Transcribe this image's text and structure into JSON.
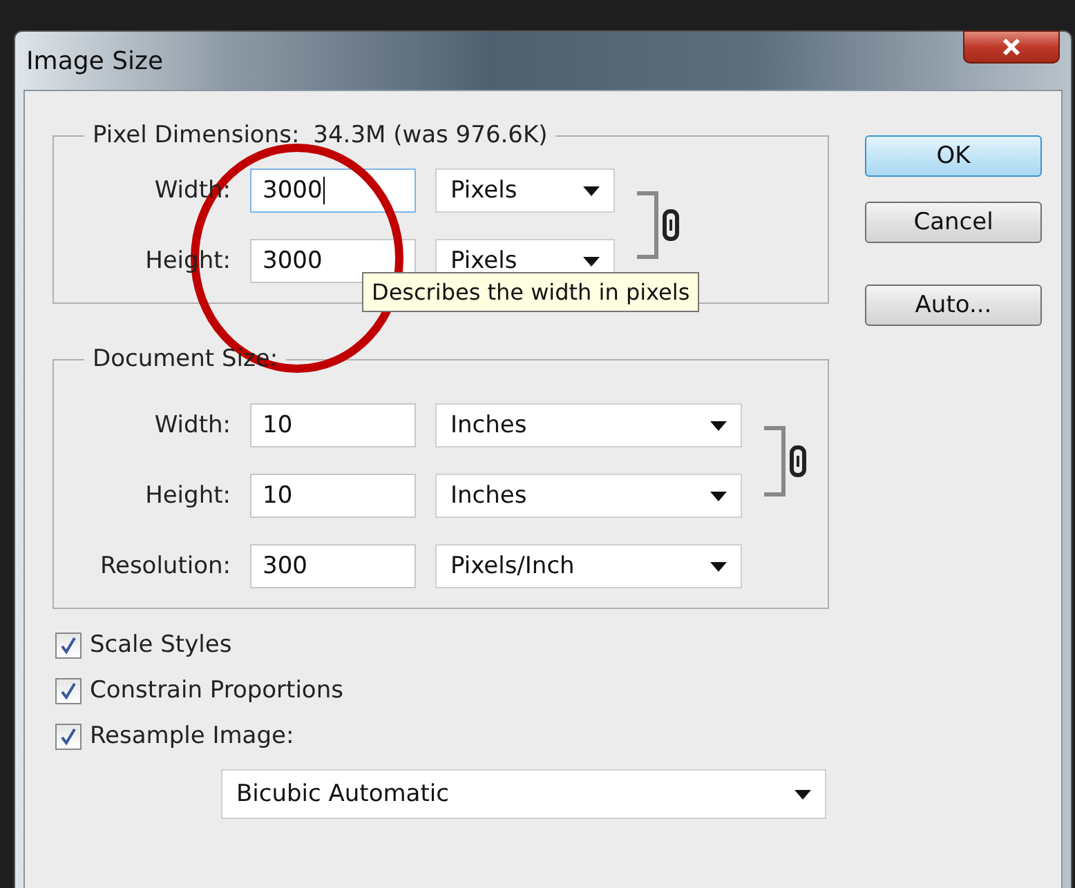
{
  "window": {
    "title": "Image Size"
  },
  "pixel_dimensions": {
    "label": "Pixel Dimensions:",
    "summary": "34.3M (was 976.6K)",
    "fields": [
      {
        "label": "Width:",
        "value": "3000",
        "unit": "Pixels",
        "focused": true
      },
      {
        "label": "Height:",
        "value": "3000",
        "unit": "Pixels",
        "focused": false
      }
    ]
  },
  "tooltip": "Describes the width in pixels",
  "document_size": {
    "label": "Document Size:",
    "fields": [
      {
        "label": "Width:",
        "value": "10",
        "unit": "Inches",
        "focused": false
      },
      {
        "label": "Height:",
        "value": "10",
        "unit": "Inches",
        "focused": false
      },
      {
        "label": "Resolution:",
        "value": "300",
        "unit": "Pixels/Inch",
        "focused": false
      }
    ]
  },
  "options": [
    {
      "label": "Scale Styles",
      "checked": true
    },
    {
      "label": "Constrain Proportions",
      "checked": true
    },
    {
      "label": "Resample Image:",
      "checked": true
    }
  ],
  "resample_method": "Bicubic Automatic",
  "buttons": [
    {
      "label": "OK",
      "default": true
    },
    {
      "label": "Cancel",
      "default": false
    },
    {
      "label": "Auto...",
      "default": false
    }
  ]
}
